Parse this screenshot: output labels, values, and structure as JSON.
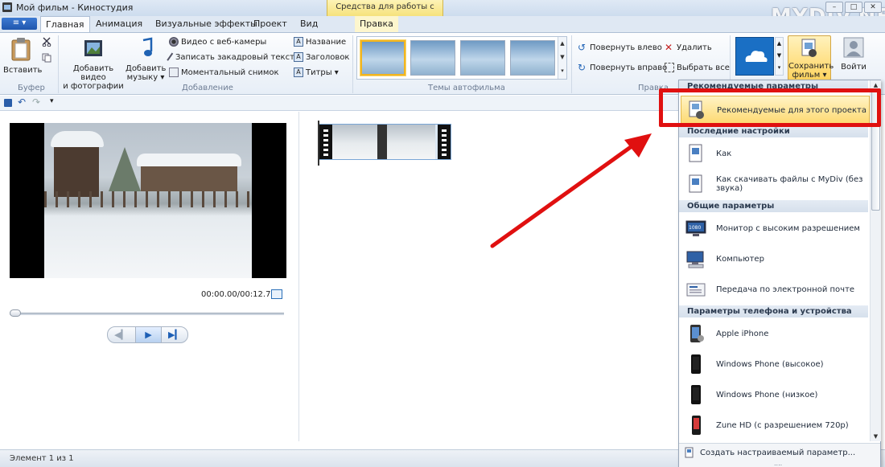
{
  "window": {
    "title": "Мой фильм - Киностудия",
    "context_tab_title": "Средства для работы с видео",
    "watermark": "MYDIV.NET"
  },
  "tabs": [
    {
      "label": "Главная",
      "active": true
    },
    {
      "label": "Анимация"
    },
    {
      "label": "Визуальные эффекты"
    },
    {
      "label": "Проект"
    },
    {
      "label": "Вид"
    },
    {
      "label": "Правка",
      "context": true
    }
  ],
  "ribbon": {
    "clipboard": {
      "paste": "Вставить",
      "group": "Буфер"
    },
    "add": {
      "add_video_line1": "Добавить видео",
      "add_video_line2": "и фотографии",
      "add_music_line1": "Добавить",
      "add_music_line2": "музыку",
      "webcam": "Видео с веб-камеры",
      "narration": "Записать закадровый текст",
      "snapshot": "Моментальный снимок",
      "title": "Название",
      "caption": "Заголовок",
      "credits": "Титры",
      "group": "Добавление"
    },
    "themes": {
      "group": "Темы автофильма"
    },
    "editing": {
      "rotate_left": "Повернуть влево",
      "rotate_right": "Повернуть вправо",
      "delete": "Удалить",
      "select_all": "Выбрать все",
      "group": "Правка"
    },
    "save_line1": "Сохранить",
    "save_line2": "фильм",
    "signin": "Войти"
  },
  "preview": {
    "timecode": "00:00.00/00:12.75"
  },
  "dropdown": {
    "sections": [
      {
        "header": "Рекомендуемые параметры",
        "items": [
          {
            "label": "Рекомендуемые для этого проекта",
            "highlighted": true
          }
        ]
      },
      {
        "header": "Последние настройки",
        "items": [
          {
            "label": "Как"
          },
          {
            "label": "Как скачивать файлы с MyDiv (без звука)"
          }
        ]
      },
      {
        "header": "Общие параметры",
        "items": [
          {
            "label": "Монитор с высоким разрешением"
          },
          {
            "label": "Компьютер"
          },
          {
            "label": "Передача по электронной почте"
          }
        ]
      },
      {
        "header": "Параметры телефона и устройства",
        "items": [
          {
            "label": "Apple iPhone"
          },
          {
            "label": "Windows Phone (высокое)"
          },
          {
            "label": "Windows Phone (низкое)"
          },
          {
            "label": "Zune HD (с разрешением 720p)"
          }
        ]
      }
    ],
    "footer": "Создать настраиваемый параметр...",
    "footer_grip": "....",
    "monitor_badge": "1080"
  },
  "status": {
    "text": "Элемент 1 из 1"
  },
  "colors": {
    "highlight": "#fed971",
    "red_box": "#e01010",
    "accent": "#1f56ad"
  }
}
